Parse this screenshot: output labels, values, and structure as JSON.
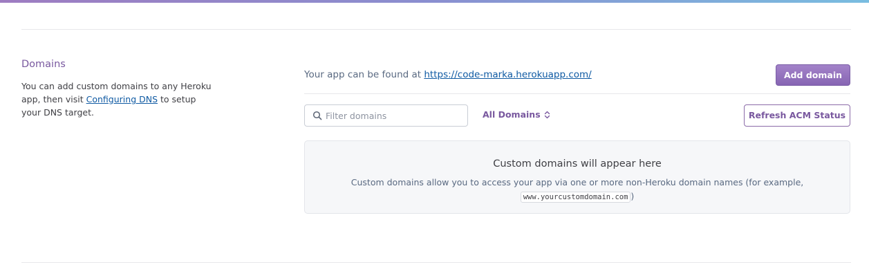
{
  "section": {
    "title": "Domains",
    "description_before": "You can add custom domains to any Heroku app, then visit ",
    "description_link": "Configuring DNS",
    "description_after": " to setup your DNS target."
  },
  "app_url": {
    "prefix": "Your app can be found at ",
    "url": "https://code-marka.herokuapp.com/"
  },
  "buttons": {
    "add_domain": "Add domain",
    "refresh_acm": "Refresh ACM Status"
  },
  "filter": {
    "placeholder": "Filter domains",
    "value": ""
  },
  "domain_type_select": {
    "selected": "All Domains"
  },
  "empty_state": {
    "heading": "Custom domains will appear here",
    "text": "Custom domains allow you to access your app via one or more non-Heroku domain names (for example,",
    "example": "www.yourcustomdomain.com",
    "closing": ")"
  },
  "colors": {
    "accent": "#79589f",
    "link": "#0f5aa3"
  },
  "icons": [
    "search-icon",
    "chevron-up-down-icon"
  ]
}
